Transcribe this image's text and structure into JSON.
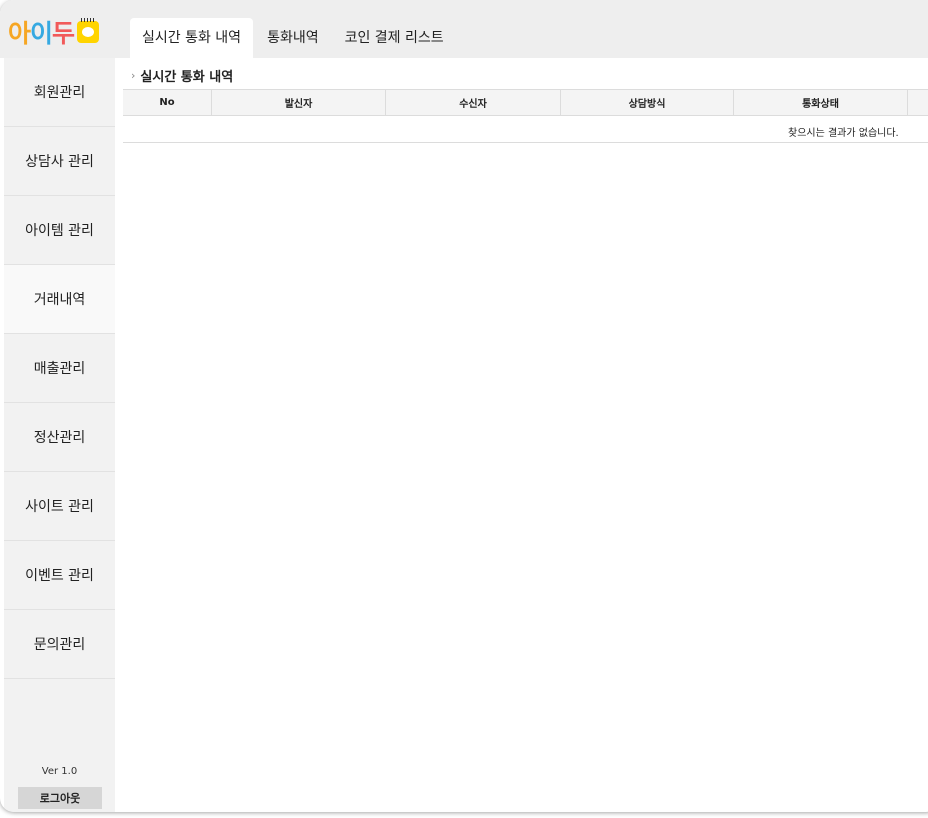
{
  "logo": {
    "part1": "아",
    "part2": "이",
    "part3": "두",
    "icon": "chick-icon"
  },
  "tabs": [
    {
      "label": "실시간 통화 내역",
      "active": true
    },
    {
      "label": "통화내역",
      "active": false
    },
    {
      "label": "코인 결제 리스트",
      "active": false
    }
  ],
  "sidebar": {
    "items": [
      {
        "label": "회원관리"
      },
      {
        "label": "상담사 관리"
      },
      {
        "label": "아이템 관리"
      },
      {
        "label": "거래내역",
        "active": true
      },
      {
        "label": "매출관리"
      },
      {
        "label": "정산관리"
      },
      {
        "label": "사이트 관리"
      },
      {
        "label": "이벤트 관리"
      },
      {
        "label": "문의관리"
      }
    ],
    "version": "Ver 1.0",
    "logout_label": "로그아웃"
  },
  "main": {
    "section_title": "실시간 통화 내역",
    "columns": [
      "No",
      "발신자",
      "수신자",
      "상담방식",
      "통화상태"
    ],
    "empty_message": "찾으시는 결과가 없습니다."
  },
  "colors": {
    "topbar_bg": "#eeeeee",
    "sidebar_bg": "#f2f2f2",
    "logo_orange": "#f6a623",
    "logo_blue": "#36a9e1",
    "logo_red": "#f15a5a",
    "logo_yellow": "#ffd400"
  }
}
